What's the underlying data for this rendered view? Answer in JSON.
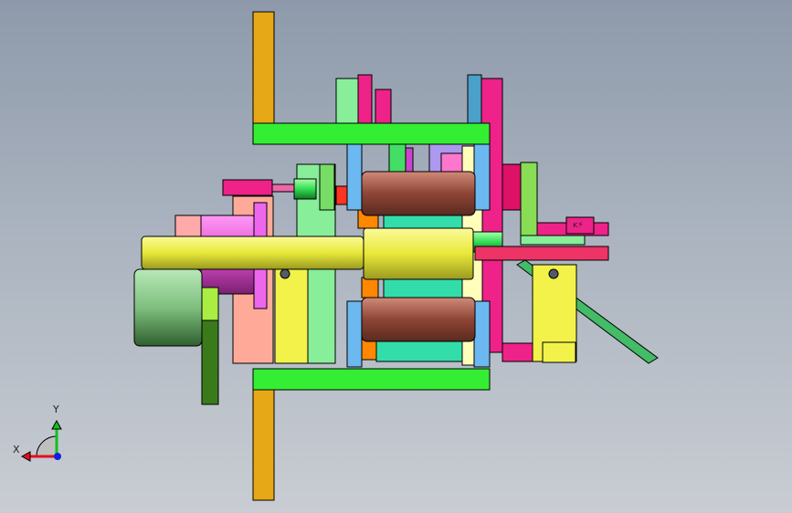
{
  "viewport": {
    "background_top": "#8e9aab",
    "background_bottom": "#c9cdd3"
  },
  "triad": {
    "x_label": "X",
    "y_label": "Y",
    "x_color": "#e01020",
    "y_color": "#10c020",
    "z_color": "#1020e0"
  },
  "part_tag": "ĸ⚡",
  "palette": {
    "frame_green": "#33ee33",
    "post_orange": "#e6a817",
    "shaft_yellow": "#f2f24a",
    "roller_brown": "#9a4a3a",
    "motor_magenta": "#ee55dd",
    "gear_green": "#7fbf7f",
    "block_blue": "#6cb8f0",
    "bracket_pink": "#ee2288"
  }
}
